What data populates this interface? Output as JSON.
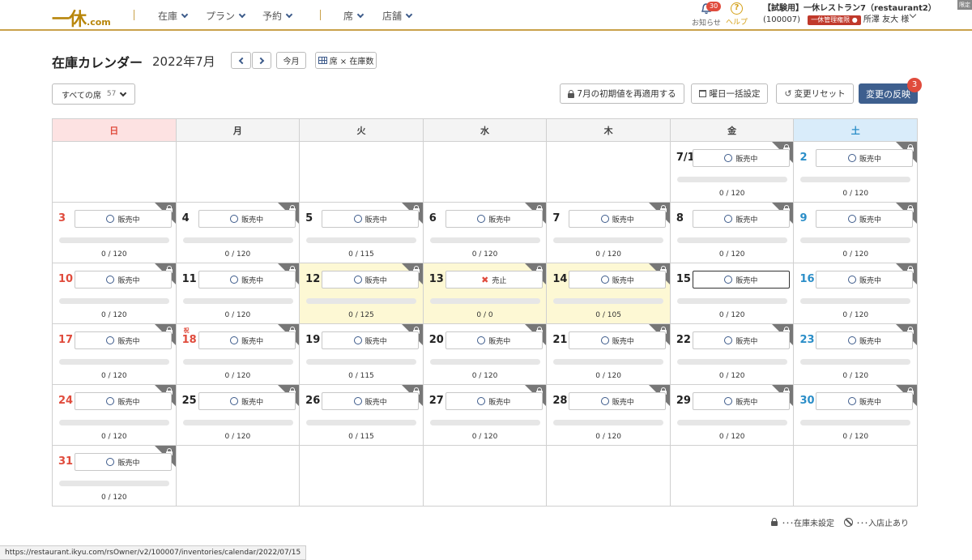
{
  "header": {
    "logo_text": "一休",
    "logo_suffix": ".com",
    "nav": [
      {
        "label": "在庫"
      },
      {
        "label": "プラン"
      },
      {
        "label": "予約"
      },
      {
        "label": "席"
      },
      {
        "label": "店舗"
      }
    ],
    "notifications": {
      "label": "お知らせ",
      "count": "30",
      "icon": "bell-icon"
    },
    "help": {
      "label": "ヘルプ",
      "icon": "question-circle-icon",
      "glyph": "?"
    },
    "account": {
      "line1": "【試験用】一休レストラン7（restaurant2）",
      "id": "(100007)",
      "role": "一休管理権限",
      "user": "所澤 友大 様"
    },
    "corner_tag": "限定"
  },
  "page": {
    "title": "在庫カレンダー",
    "month": "2022年7月",
    "today_button": "今月",
    "view_toggle": "席 × 在庫数",
    "seat_filter": {
      "label": "すべての席",
      "count": "57"
    },
    "reapply_button": "7月の初期値を再適用する",
    "weekday_button": "曜日一括設定",
    "reset_button": "変更リセット",
    "apply_button": "変更の反映",
    "apply_badge": "3"
  },
  "calendar": {
    "weekdays": [
      "日",
      "月",
      "火",
      "水",
      "木",
      "金",
      "土"
    ],
    "status_on": "販売中",
    "status_off": "売止",
    "holiday_mark": "祝",
    "weeks": [
      [
        null,
        null,
        null,
        null,
        null,
        {
          "day": "7/1",
          "status": "on",
          "count": "0 / 120",
          "reserved": 0,
          "capacity": 120
        },
        {
          "day": "2",
          "status": "on",
          "count": "0 / 120",
          "reserved": 0,
          "capacity": 120
        }
      ],
      [
        {
          "day": "3",
          "status": "on",
          "count": "0 / 120",
          "reserved": 0,
          "capacity": 120
        },
        {
          "day": "4",
          "status": "on",
          "count": "0 / 120",
          "reserved": 0,
          "capacity": 120
        },
        {
          "day": "5",
          "status": "on",
          "count": "0 / 115",
          "reserved": 0,
          "capacity": 115
        },
        {
          "day": "6",
          "status": "on",
          "count": "0 / 120",
          "reserved": 0,
          "capacity": 120
        },
        {
          "day": "7",
          "status": "on",
          "count": "0 / 120",
          "reserved": 0,
          "capacity": 120
        },
        {
          "day": "8",
          "status": "on",
          "count": "0 / 120",
          "reserved": 0,
          "capacity": 120
        },
        {
          "day": "9",
          "status": "on",
          "count": "0 / 120",
          "reserved": 0,
          "capacity": 120
        }
      ],
      [
        {
          "day": "10",
          "status": "on",
          "count": "0 / 120",
          "reserved": 0,
          "capacity": 120
        },
        {
          "day": "11",
          "status": "on",
          "count": "0 / 120",
          "reserved": 0,
          "capacity": 120
        },
        {
          "day": "12",
          "status": "on",
          "count": "0 / 125",
          "reserved": 0,
          "capacity": 125,
          "changed": true
        },
        {
          "day": "13",
          "status": "off",
          "count": "0 / 0",
          "reserved": 0,
          "capacity": 0,
          "changed": true
        },
        {
          "day": "14",
          "status": "on",
          "count": "0 / 105",
          "reserved": 0,
          "capacity": 105,
          "changed": true
        },
        {
          "day": "15",
          "status": "on",
          "count": "0 / 120",
          "reserved": 0,
          "capacity": 120,
          "selected": true,
          "unlocked": true
        },
        {
          "day": "16",
          "status": "on",
          "count": "0 / 120",
          "reserved": 0,
          "capacity": 120
        }
      ],
      [
        {
          "day": "17",
          "status": "on",
          "count": "0 / 120",
          "reserved": 0,
          "capacity": 120
        },
        {
          "day": "18",
          "status": "on",
          "count": "0 / 120",
          "reserved": 0,
          "capacity": 120,
          "holiday": true
        },
        {
          "day": "19",
          "status": "on",
          "count": "0 / 115",
          "reserved": 0,
          "capacity": 115
        },
        {
          "day": "20",
          "status": "on",
          "count": "0 / 120",
          "reserved": 0,
          "capacity": 120
        },
        {
          "day": "21",
          "status": "on",
          "count": "0 / 120",
          "reserved": 0,
          "capacity": 120
        },
        {
          "day": "22",
          "status": "on",
          "count": "0 / 120",
          "reserved": 0,
          "capacity": 120
        },
        {
          "day": "23",
          "status": "on",
          "count": "0 / 120",
          "reserved": 0,
          "capacity": 120
        }
      ],
      [
        {
          "day": "24",
          "status": "on",
          "count": "0 / 120",
          "reserved": 0,
          "capacity": 120
        },
        {
          "day": "25",
          "status": "on",
          "count": "0 / 120",
          "reserved": 0,
          "capacity": 120
        },
        {
          "day": "26",
          "status": "on",
          "count": "0 / 115",
          "reserved": 0,
          "capacity": 115
        },
        {
          "day": "27",
          "status": "on",
          "count": "0 / 120",
          "reserved": 0,
          "capacity": 120
        },
        {
          "day": "28",
          "status": "on",
          "count": "0 / 120",
          "reserved": 0,
          "capacity": 120
        },
        {
          "day": "29",
          "status": "on",
          "count": "0 / 120",
          "reserved": 0,
          "capacity": 120
        },
        {
          "day": "30",
          "status": "on",
          "count": "0 / 120",
          "reserved": 0,
          "capacity": 120
        }
      ],
      [
        {
          "day": "31",
          "status": "on",
          "count": "0 / 120",
          "reserved": 0,
          "capacity": 120
        },
        null,
        null,
        null,
        null,
        null,
        null
      ]
    ]
  },
  "legend": {
    "lock_label": "･･･在庫未設定",
    "noentry_label": "･･･入店止あり"
  },
  "statusbar": {
    "url": "https://restaurant.ikyu.com/rsOwner/v2/100007/inventories/calendar/2022/07/15"
  },
  "colors": {
    "accent_gold": "#c9a14a",
    "primary_blue": "#3e5f8e",
    "sunday_red": "#e04b3c",
    "saturday_blue": "#2b8ec8",
    "changed_yellow": "#fdf8d4"
  }
}
